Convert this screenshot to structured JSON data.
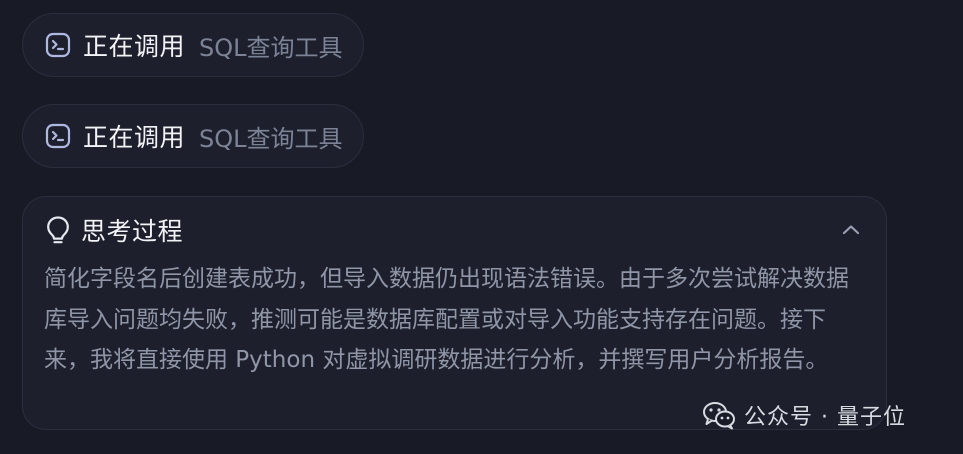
{
  "tool_calls": [
    {
      "label": "正在调用",
      "tool": "SQL查询工具",
      "icon": "terminal-icon"
    },
    {
      "label": "正在调用",
      "tool": "SQL查询工具",
      "icon": "terminal-icon"
    }
  ],
  "thinking": {
    "title": "思考过程",
    "icon": "lightbulb-icon",
    "collapse_icon": "chevron-up-icon",
    "content": "简化字段名后创建表成功，但导入数据仍出现语法错误。由于多次尝试解决数据库导入问题均失败，推测可能是数据库配置或对导入功能支持存在问题。接下来，我将直接使用 Python 对虚拟调研数据进行分析，并撰写用户分析报告。"
  },
  "watermark": {
    "text": "公众号 · 量子位",
    "icon": "wechat-icon"
  },
  "colors": {
    "background": "#181b26",
    "card": "#1d202c",
    "border": "#2b2f3d",
    "text_primary": "#f2f3f7",
    "text_secondary": "#9096a7"
  }
}
